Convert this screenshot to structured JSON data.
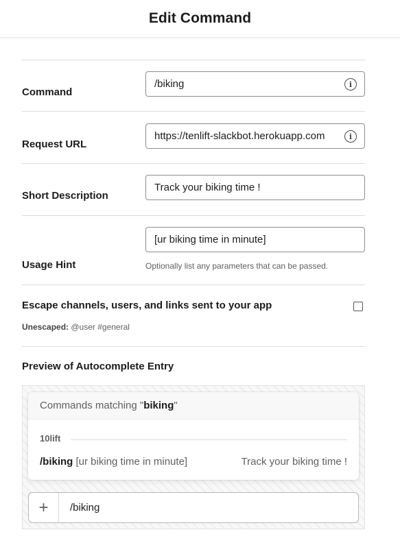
{
  "header": {
    "title": "Edit Command"
  },
  "form": {
    "command": {
      "label": "Command",
      "value": "/biking"
    },
    "request_url": {
      "label": "Request URL",
      "value": "https://tenlift-slackbot.herokuapp.com"
    },
    "short_description": {
      "label": "Short Description",
      "value": "Track your biking time !"
    },
    "usage_hint": {
      "label": "Usage Hint",
      "value": "[ur biking time in minute]",
      "help": "Optionally list any parameters that can be passed."
    },
    "escape": {
      "label": "Escape channels, users, and links sent to your app",
      "checked": false,
      "example_label": "Unescaped:",
      "example_value": " @user #general"
    }
  },
  "preview": {
    "title": "Preview of Autocomplete Entry",
    "header_prefix": "Commands matching \"",
    "header_query": "biking",
    "header_suffix": "\"",
    "app_name": "10lift",
    "command": "/biking",
    "hint": " [ur biking time in minute]",
    "description": "Track your biking time !",
    "composer_text": "/biking"
  },
  "icons": {
    "info": "info-icon",
    "plus": "plus-icon"
  }
}
